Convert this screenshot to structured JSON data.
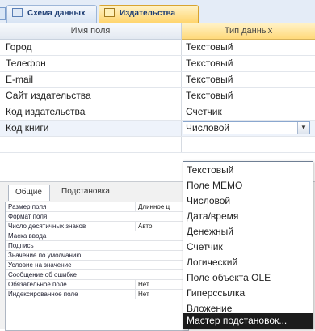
{
  "tabs": [
    {
      "label": "Схема данных",
      "active": false
    },
    {
      "label": "Издательства",
      "active": true
    }
  ],
  "grid": {
    "header_name": "Имя поля",
    "header_type": "Тип данных",
    "rows": [
      {
        "name": "Город",
        "type": "Текстовый"
      },
      {
        "name": "Телефон",
        "type": "Текстовый"
      },
      {
        "name": "E-mail",
        "type": "Текстовый"
      },
      {
        "name": "Сайт издательства",
        "type": "Текстовый"
      },
      {
        "name": "Код издательства",
        "type": "Счетчик"
      },
      {
        "name": "Код книги",
        "type": "Числовой"
      }
    ]
  },
  "bottom": {
    "tab_general": "Общие",
    "tab_lookup": "Подстановка",
    "properties": [
      {
        "label": "Размер поля",
        "value": "Длинное ц"
      },
      {
        "label": "Формат поля",
        "value": ""
      },
      {
        "label": "Число десятичных знаков",
        "value": "Авто"
      },
      {
        "label": "Маска ввода",
        "value": ""
      },
      {
        "label": "Подпись",
        "value": ""
      },
      {
        "label": "Значение по умолчанию",
        "value": ""
      },
      {
        "label": "Условие на значение",
        "value": ""
      },
      {
        "label": "Сообщение об ошибке",
        "value": ""
      },
      {
        "label": "Обязательное поле",
        "value": "Нет"
      },
      {
        "label": "Индексированное поле",
        "value": "Нет"
      }
    ]
  },
  "dropdown": {
    "options": [
      "Текстовый",
      "Поле МЕМО",
      "Числовой",
      "Дата/время",
      "Денежный",
      "Счетчик",
      "Логический",
      "Поле объекта OLE",
      "Гиперссылка",
      "Вложение",
      "Мастер подстановок..."
    ],
    "highlighted_index": 10
  }
}
